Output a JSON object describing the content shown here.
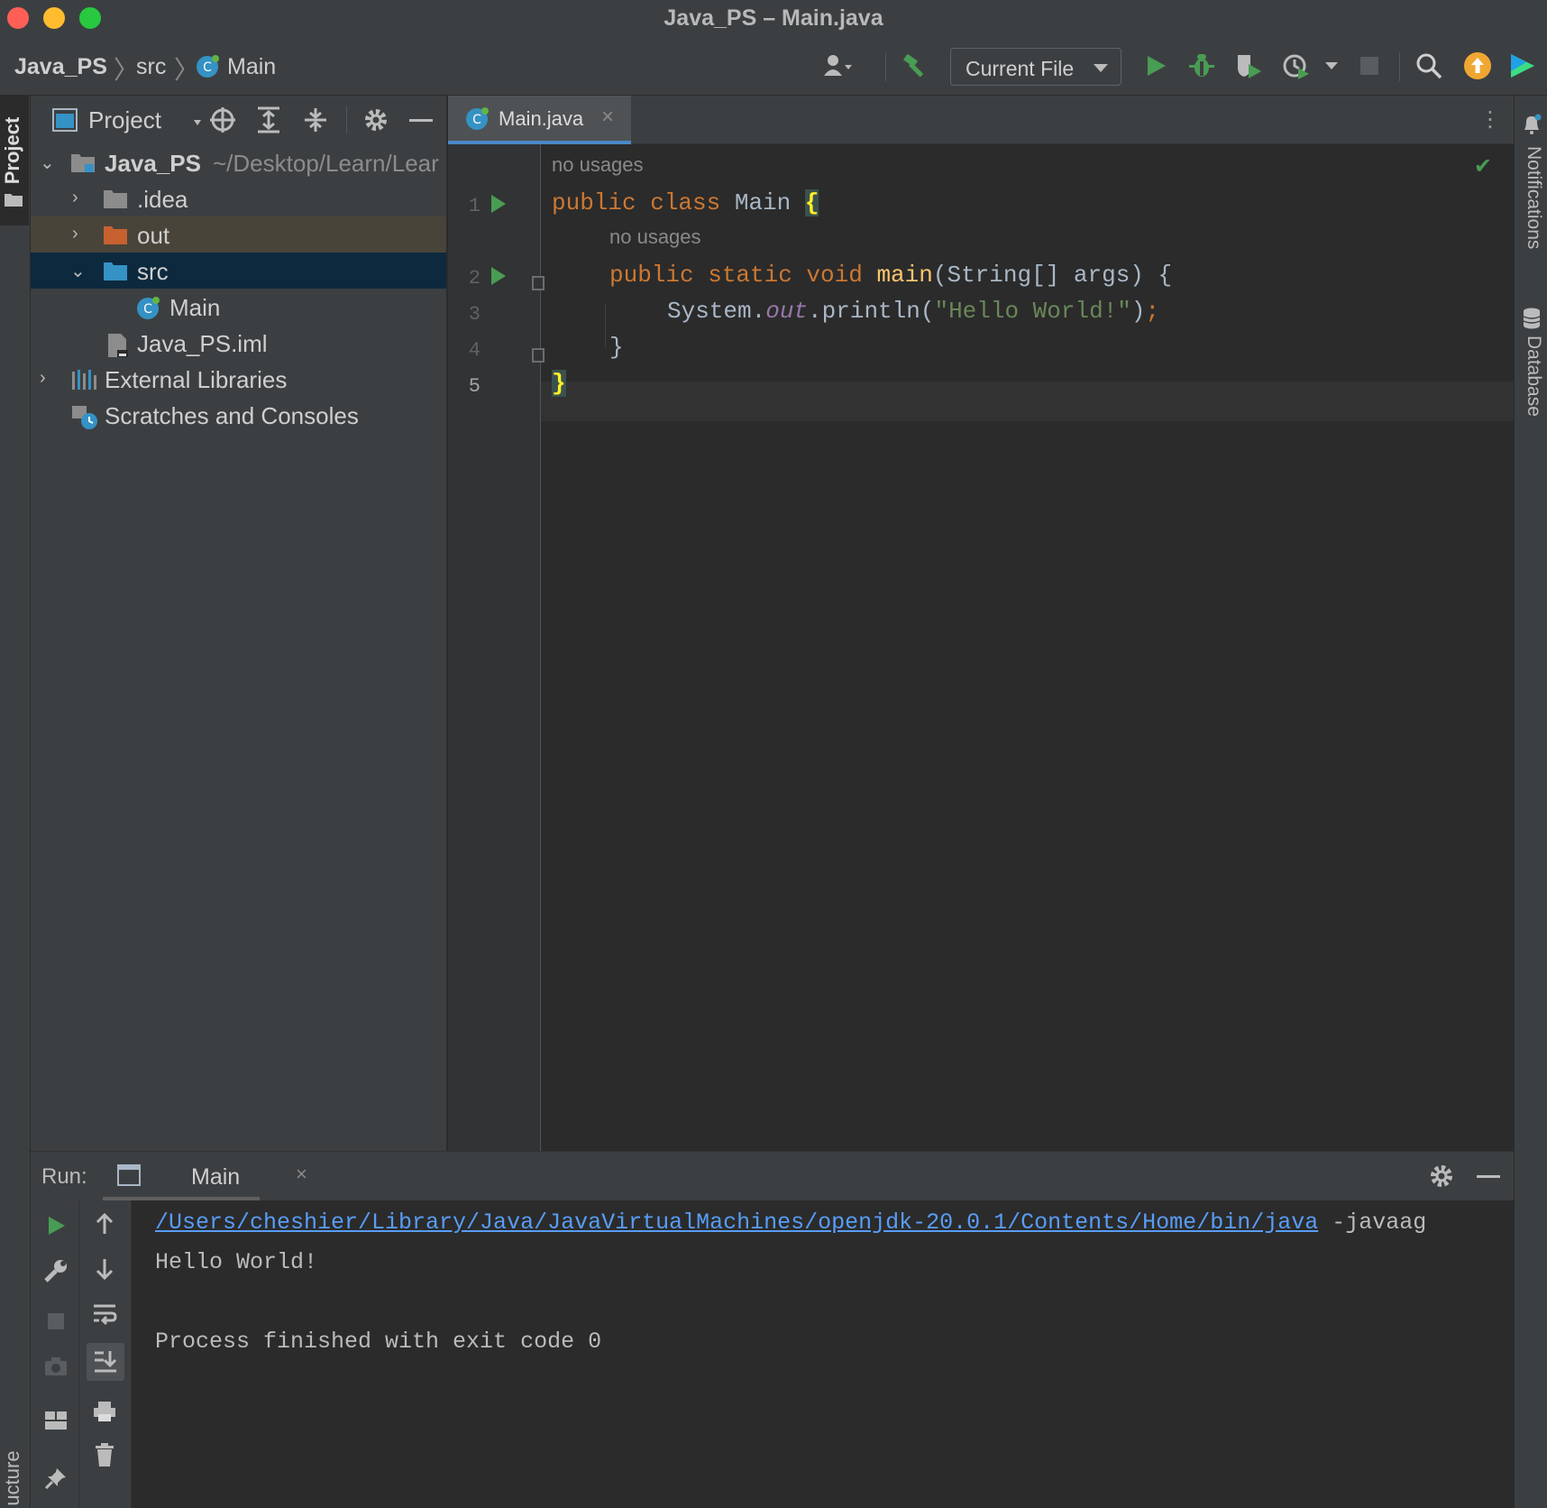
{
  "window": {
    "title": "Java_PS – Main.java"
  },
  "breadcrumb": {
    "project": "Java_PS",
    "folder": "src",
    "file": "Main"
  },
  "toolbar": {
    "run_config": "Current File",
    "icons": [
      "user-icon",
      "build-hammer-icon",
      "run-icon",
      "debug-icon",
      "coverage-icon",
      "profile-icon",
      "stop-icon",
      "search-icon",
      "update-icon",
      "jetbrains-toolbox-icon"
    ]
  },
  "left_stripe": {
    "project_label": "Project",
    "structure_label": "ucture"
  },
  "project_panel": {
    "title": "Project",
    "tree": [
      {
        "label": "Java_PS",
        "path": "~/Desktop/Learn/Lear",
        "expanded": true
      },
      {
        "label": ".idea",
        "expanded": false
      },
      {
        "label": "out",
        "expanded": false
      },
      {
        "label": "src",
        "expanded": true
      },
      {
        "label": "Main"
      },
      {
        "label": "Java_PS.iml"
      },
      {
        "label": "External Libraries",
        "expanded": false
      },
      {
        "label": "Scratches and Consoles"
      }
    ]
  },
  "editor": {
    "tab_label": "Main.java",
    "inlay_hint": "no usages",
    "line_numbers": [
      "1",
      "2",
      "3",
      "4",
      "5"
    ],
    "code": {
      "l1_kw": "public class ",
      "l1_name": "Main ",
      "l1_brace": "{",
      "l2_kw": "public static void ",
      "l2_fn": "main",
      "l2_rest": "(String[] args) {",
      "l3_a": "System.",
      "l3_field": "out",
      "l3_b": ".println(",
      "l3_str": "\"Hello World!\"",
      "l3_c": ")",
      "l3_semi": ";",
      "l4": "}",
      "l5": "}"
    }
  },
  "right_stripe": {
    "notifications": "Notifications",
    "database": "Database"
  },
  "run_panel": {
    "label": "Run:",
    "tab": "Main",
    "console": {
      "java_path": "/Users/cheshier/Library/Java/JavaVirtualMachines/openjdk-20.0.1/Contents/Home/bin/java",
      "args": " -javaag",
      "output": "Hello World!",
      "exit": "Process finished with exit code 0"
    }
  },
  "colors": {
    "accent": "#4a88c7",
    "run_green": "#499c54",
    "keyword": "#cc7832",
    "string": "#6a8759"
  }
}
